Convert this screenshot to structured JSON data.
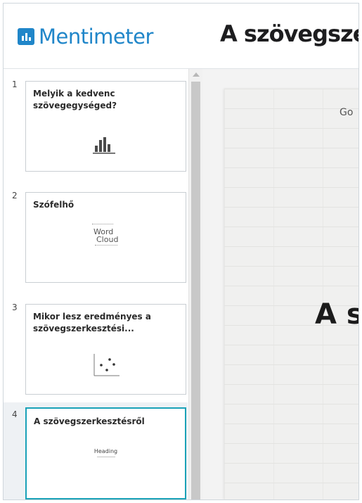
{
  "app": {
    "logo_text": "Mentimeter",
    "presentation_title": "A szövegsze",
    "brand_color": "#2086c9",
    "active_color": "#1aa2b8"
  },
  "sidebar": {
    "slides": [
      {
        "number": "1",
        "title": "Melyik a kedvenc szövegegységed?",
        "icon": "bar-chart-icon"
      },
      {
        "number": "2",
        "title": "Szófelhő",
        "icon": "word-cloud-icon",
        "icon_text_1": "Word",
        "icon_text_2": "Cloud"
      },
      {
        "number": "3",
        "title": "Mikor lesz eredményes a szövegszerkesztési...",
        "icon": "scatter-icon"
      },
      {
        "number": "4",
        "title": "A szövegszerkesztésről",
        "icon": "heading-icon",
        "icon_text": "Heading",
        "active": true
      }
    ]
  },
  "preview": {
    "top_text": "Go",
    "big_text": "A s"
  }
}
